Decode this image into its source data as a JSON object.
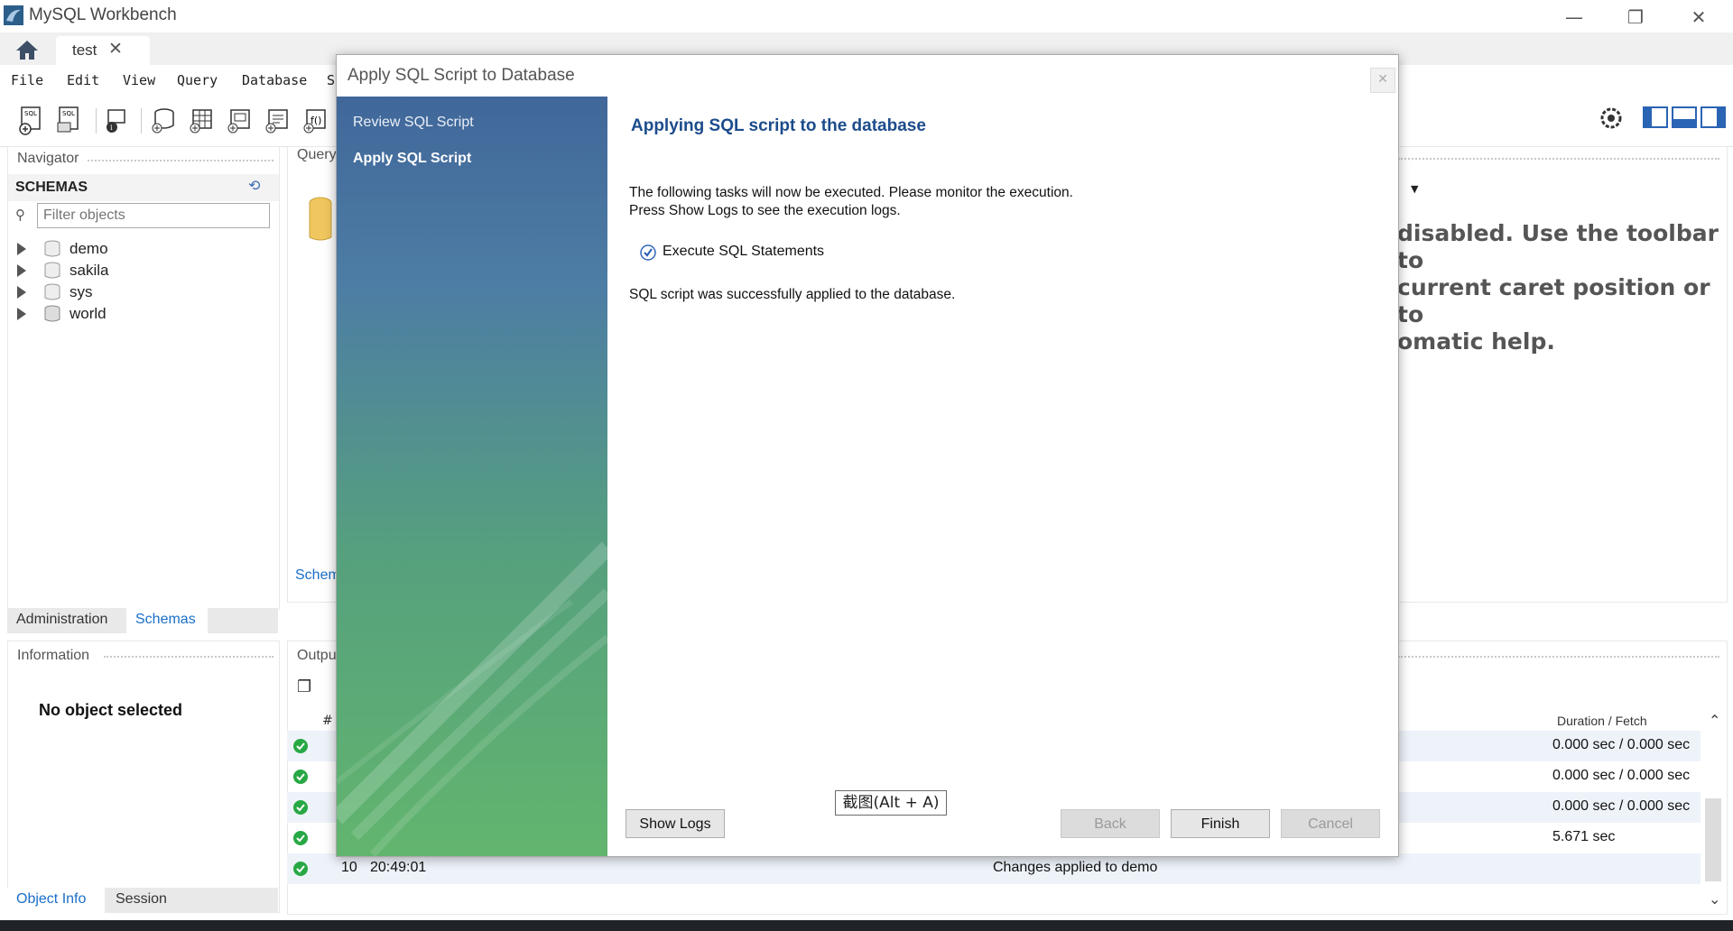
{
  "window": {
    "app_title": "MySQL Workbench",
    "tab_label": "test",
    "tab_close": "✕",
    "minimize": "—",
    "restore": "❐",
    "close": "✕"
  },
  "menu": [
    "File",
    "Edit",
    "View",
    "Query",
    "Database",
    "S"
  ],
  "navigator": {
    "title": "Navigator",
    "schemas_header": "SCHEMAS",
    "filter_placeholder": "Filter objects",
    "schemas": [
      "demo",
      "sakila",
      "sys",
      "world"
    ],
    "tabs": [
      "Administration",
      "Schemas"
    ]
  },
  "information": {
    "title": "Information",
    "empty_text": "No object selected",
    "tabs": [
      "Object Info",
      "Session"
    ]
  },
  "query_panel": {
    "title_fragment": "Query",
    "schema_fragment": "Schem",
    "help_lines": [
      "disabled. Use the toolbar to",
      "current caret position or to",
      "omatic help."
    ]
  },
  "output_panel": {
    "title_fragment": "Outpu",
    "col_hash": "#",
    "col_duration": "Duration / Fetch",
    "rows": [
      {
        "num": "",
        "time": "",
        "message": "",
        "duration": "0.000 sec / 0.000 sec"
      },
      {
        "num": "",
        "time": "",
        "message": "",
        "duration": "0.000 sec / 0.000 sec"
      },
      {
        "num": "",
        "time": "",
        "message": "",
        "duration": "0.000 sec / 0.000 sec"
      },
      {
        "num": "",
        "time": "",
        "message": "",
        "duration": "5.671 sec"
      },
      {
        "num": "10",
        "time": "20:49:01",
        "message": "Changes applied to demo",
        "duration": ""
      }
    ]
  },
  "dialog": {
    "title": "Apply SQL Script to Database",
    "close": "✕",
    "steps": [
      "Review SQL Script",
      "Apply SQL Script"
    ],
    "heading": "Applying SQL script to the database",
    "intro_line1": "The following tasks will now be executed. Please monitor the execution.",
    "intro_line2": "Press Show Logs to see the execution logs.",
    "task_label": "Execute SQL Statements",
    "result_text": "SQL script was successfully applied to the database.",
    "buttons": {
      "show_logs": "Show Logs",
      "back": "Back",
      "finish": "Finish",
      "cancel": "Cancel"
    }
  },
  "tooltip": "截图(Alt + A)",
  "colors": {
    "accent_blue": "#1c4c8c",
    "success_green": "#27a844",
    "link_blue": "#1a6fc9"
  }
}
